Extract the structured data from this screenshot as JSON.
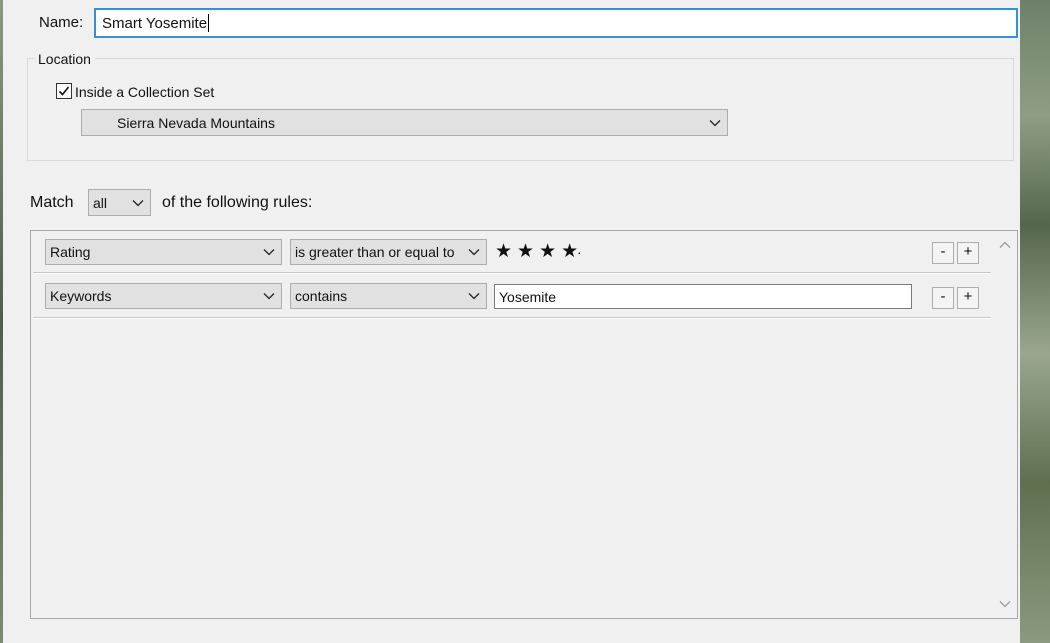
{
  "form": {
    "name_label": "Name:",
    "name_value": "Smart Yosemite",
    "location_label": "Location",
    "inside_set_label": "Inside a Collection Set",
    "inside_set_checked": true,
    "collection_set_value": "Sierra Nevada Mountains",
    "match_label": "Match",
    "match_value": "all",
    "following_label": "of the following rules:"
  },
  "rules": [
    {
      "field": "Rating",
      "operator": "is greater than or equal to",
      "stars": "★★★★",
      "star_placeholder": "·",
      "rating": 4,
      "remove_label": "-",
      "add_label": "+"
    },
    {
      "field": "Keywords",
      "operator": "contains",
      "value": "Yosemite",
      "remove_label": "-",
      "add_label": "+"
    }
  ],
  "icons": {
    "checkbox": "checkmark-icon",
    "dropdown": "chevron-down-icon",
    "scroll_up": "chevron-up-icon",
    "scroll_down": "chevron-down-icon"
  }
}
